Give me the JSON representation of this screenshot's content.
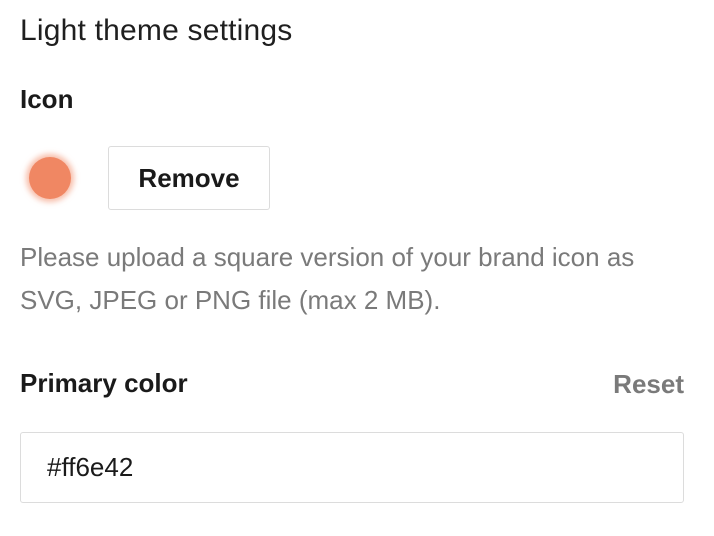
{
  "section": {
    "title": "Light theme settings"
  },
  "icon_setting": {
    "label": "Icon",
    "icon_name": "brand-icon",
    "icon_color": "#f08763",
    "remove_label": "Remove",
    "help_text": "Please upload a square version of your brand icon as SVG, JPEG or PNG file (max 2 MB)."
  },
  "primary_color": {
    "label": "Primary color",
    "reset_label": "Reset",
    "value": "#ff6e42"
  }
}
